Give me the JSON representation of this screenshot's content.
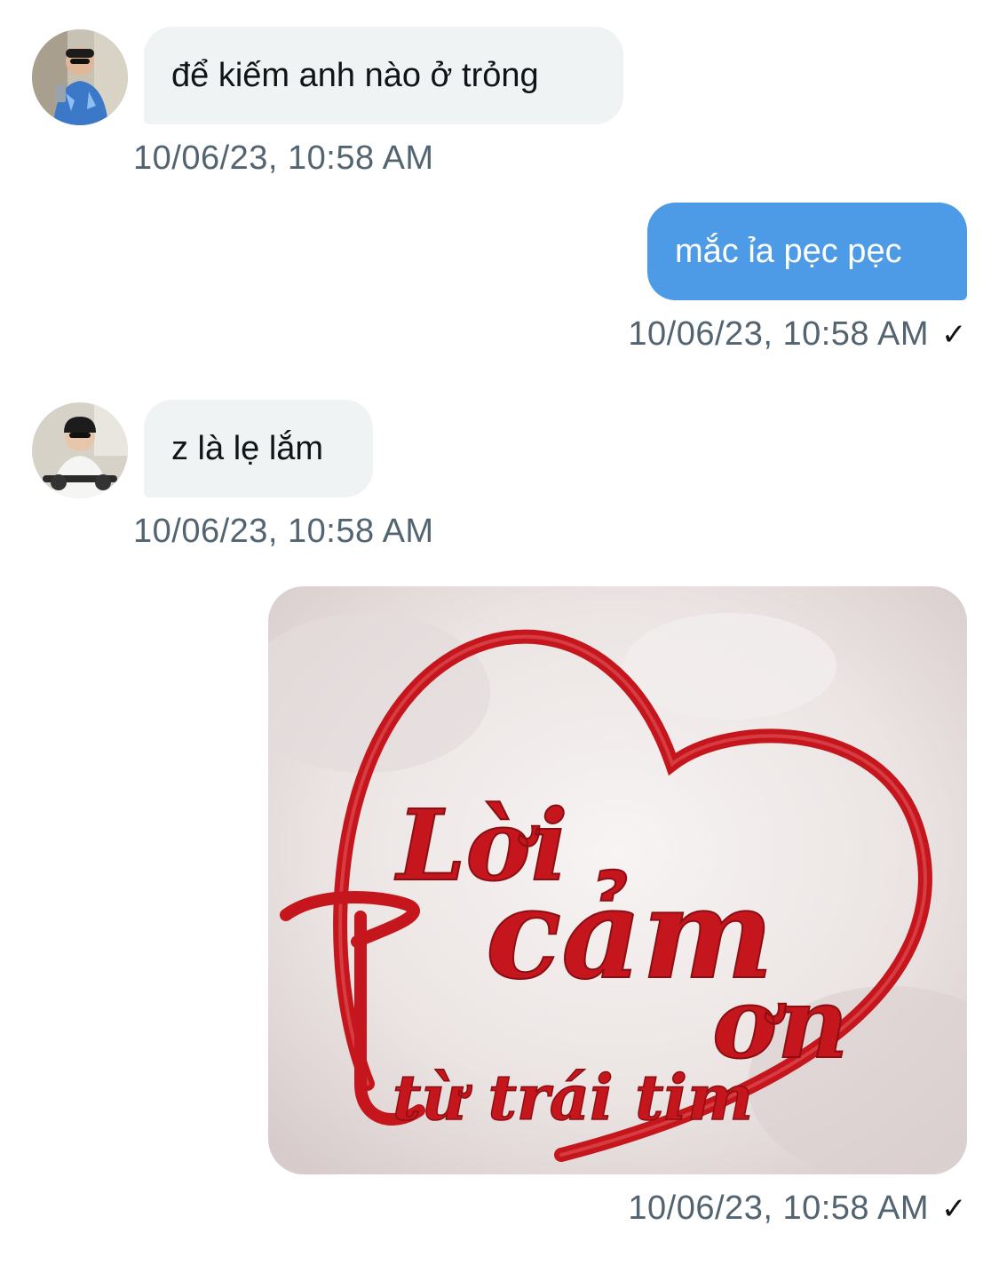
{
  "messages": [
    {
      "direction": "in",
      "text": "để kiếm anh nào ở trỏng",
      "timestamp": "10/06/23, 10:58 AM"
    },
    {
      "direction": "out",
      "text": "mắc ỉa pẹc pẹc",
      "timestamp": "10/06/23, 10:58 AM",
      "status": "✓"
    },
    {
      "direction": "in",
      "text": "z là lẹ lắm",
      "timestamp": "10/06/23, 10:58 AM"
    },
    {
      "direction": "out",
      "type": "image",
      "image": {
        "line1": "Lời",
        "line2": "cảm",
        "line3": "ơn",
        "line4": "từ trái tim"
      },
      "timestamp": "10/06/23, 10:58 AM",
      "status": "✓"
    }
  ],
  "colors": {
    "outgoing_bubble": "#4d9be6",
    "incoming_bubble": "#eff3f4",
    "timestamp": "#536471",
    "heart": "#c4161c"
  },
  "icons": {
    "sent": "check-icon"
  }
}
